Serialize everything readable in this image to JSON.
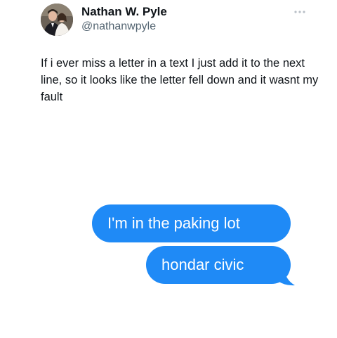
{
  "tweet": {
    "display_name": "Nathan W. Pyle",
    "handle": "@nathanwpyle",
    "text": "If i ever miss a letter in a text I just add it to the next line, so it looks like the letter fell down and it wasnt my fault",
    "more_icon": "more-dots-icon",
    "avatar_icon": "profile-photo"
  },
  "messages": [
    {
      "text": "I'm in the paking lot"
    },
    {
      "text": "hondar civic"
    }
  ],
  "colors": {
    "bubble": "#1f8af6",
    "bubble_text": "#ffffff",
    "name": "#0f1419",
    "handle": "#536471"
  }
}
